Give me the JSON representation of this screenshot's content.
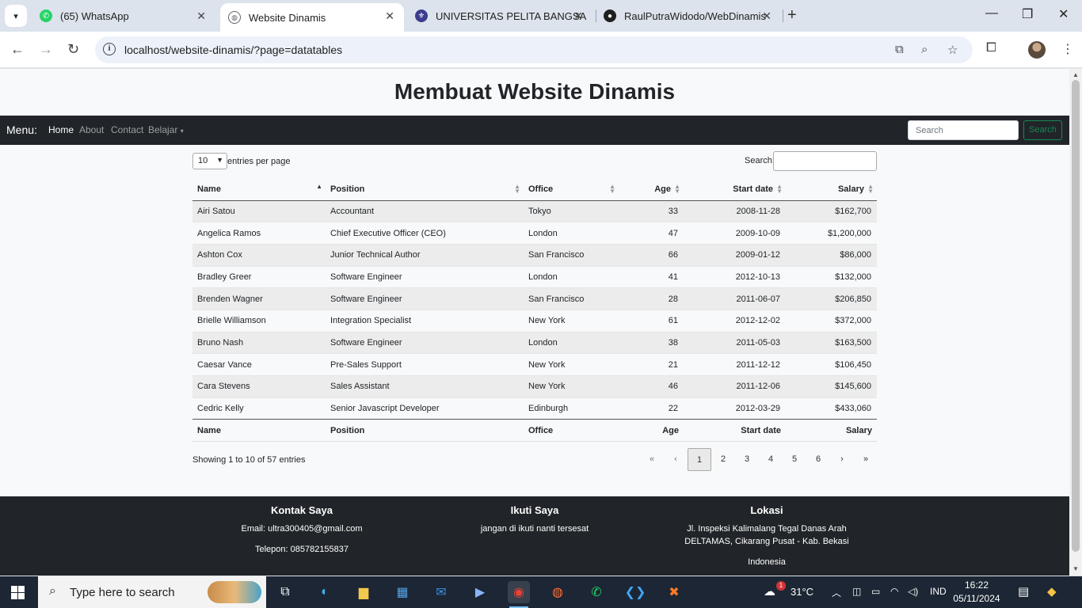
{
  "browser": {
    "tabs": [
      {
        "title": "(65) WhatsApp",
        "color": "#25d366"
      },
      {
        "title": "Website Dinamis",
        "color": "#5f6368"
      },
      {
        "title": "UNIVERSITAS PELITA BANGSA",
        "color": "#3b3b8f"
      },
      {
        "title": "RaulPutraWidodo/WebDinamis",
        "color": "#1f1f1f"
      }
    ],
    "url": "localhost/website-dinamis/?page=datatables"
  },
  "site": {
    "title": "Membuat Website Dinamis",
    "nav": {
      "brand": "Menu:",
      "links": [
        "Home",
        "About",
        "Contact",
        "Belajar"
      ],
      "search_placeholder": "Search",
      "search_button": "Search"
    }
  },
  "datatable": {
    "length_value": "10",
    "length_label": "entries per page",
    "search_label": "Search:",
    "columns": [
      "Name",
      "Position",
      "Office",
      "Age",
      "Start date",
      "Salary"
    ],
    "rows": [
      [
        "Airi Satou",
        "Accountant",
        "Tokyo",
        "33",
        "2008-11-28",
        "$162,700"
      ],
      [
        "Angelica Ramos",
        "Chief Executive Officer (CEO)",
        "London",
        "47",
        "2009-10-09",
        "$1,200,000"
      ],
      [
        "Ashton Cox",
        "Junior Technical Author",
        "San Francisco",
        "66",
        "2009-01-12",
        "$86,000"
      ],
      [
        "Bradley Greer",
        "Software Engineer",
        "London",
        "41",
        "2012-10-13",
        "$132,000"
      ],
      [
        "Brenden Wagner",
        "Software Engineer",
        "San Francisco",
        "28",
        "2011-06-07",
        "$206,850"
      ],
      [
        "Brielle Williamson",
        "Integration Specialist",
        "New York",
        "61",
        "2012-12-02",
        "$372,000"
      ],
      [
        "Bruno Nash",
        "Software Engineer",
        "London",
        "38",
        "2011-05-03",
        "$163,500"
      ],
      [
        "Caesar Vance",
        "Pre-Sales Support",
        "New York",
        "21",
        "2011-12-12",
        "$106,450"
      ],
      [
        "Cara Stevens",
        "Sales Assistant",
        "New York",
        "46",
        "2011-12-06",
        "$145,600"
      ],
      [
        "Cedric Kelly",
        "Senior Javascript Developer",
        "Edinburgh",
        "22",
        "2012-03-29",
        "$433,060"
      ]
    ],
    "info": "Showing 1 to 10 of 57 entries",
    "pagination": [
      "«",
      "‹",
      "1",
      "2",
      "3",
      "4",
      "5",
      "6",
      "›",
      "»"
    ]
  },
  "footer": {
    "contact": {
      "title": "Kontak Saya",
      "email": "Email: ultra300405@gmail.com",
      "phone": "Telepon: 085782155837"
    },
    "follow": {
      "title": "Ikuti Saya",
      "text": "jangan di ikuti nanti tersesat"
    },
    "location": {
      "title": "Lokasi",
      "address": "Jl. Inspeksi Kalimalang Tegal Danas Arah DELTAMAS, Cikarang Pusat - Kab. Bekasi",
      "country": "Indonesia"
    }
  },
  "taskbar": {
    "search_placeholder": "Type here to search",
    "weather": "31°C",
    "language": "IND",
    "time": "16:22",
    "date": "05/11/2024",
    "notif_badge": "1"
  }
}
